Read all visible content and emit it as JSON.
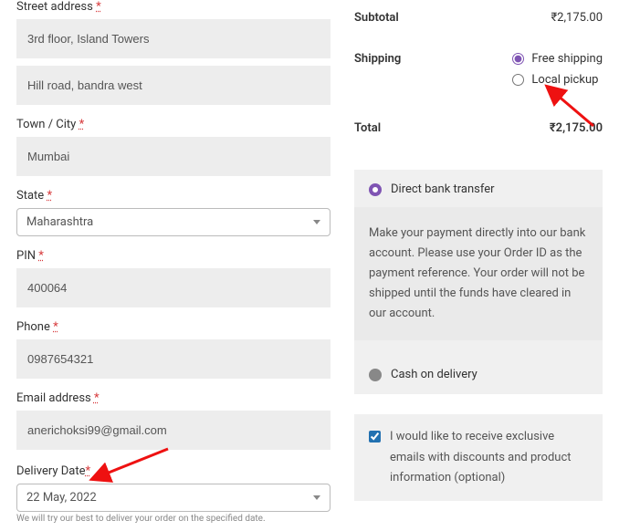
{
  "billing": {
    "street_label": "Street address",
    "street_line1": "3rd floor, Island Towers",
    "street_line2": "Hill road, bandra west",
    "city_label": "Town / City",
    "city": "Mumbai",
    "state_label": "State",
    "state": "Maharashtra",
    "pin_label": "PIN",
    "pin": "400064",
    "phone_label": "Phone",
    "phone": "0987654321",
    "email_label": "Email address",
    "email": "anerichoksi99@gmail.com",
    "delivery_label": "Delivery Date",
    "delivery_date": "22 May, 2022",
    "delivery_hint": "We will try our best to deliver your order on the specified date."
  },
  "summary": {
    "subtotal_label": "Subtotal",
    "subtotal_value": "₹2,175.00",
    "shipping_label": "Shipping",
    "shipping_free": "Free shipping",
    "shipping_pickup": "Local pickup",
    "total_label": "Total",
    "total_value": "₹2,175.00"
  },
  "payment": {
    "bank_label": "Direct bank transfer",
    "bank_desc": "Make your payment directly into our bank account. Please use your Order ID as the payment reference. Your order will not be shipped until the funds have cleared in our account.",
    "cod_label": "Cash on delivery"
  },
  "consent": {
    "text": "I would like to receive exclusive emails with discounts and product information (optional)"
  }
}
